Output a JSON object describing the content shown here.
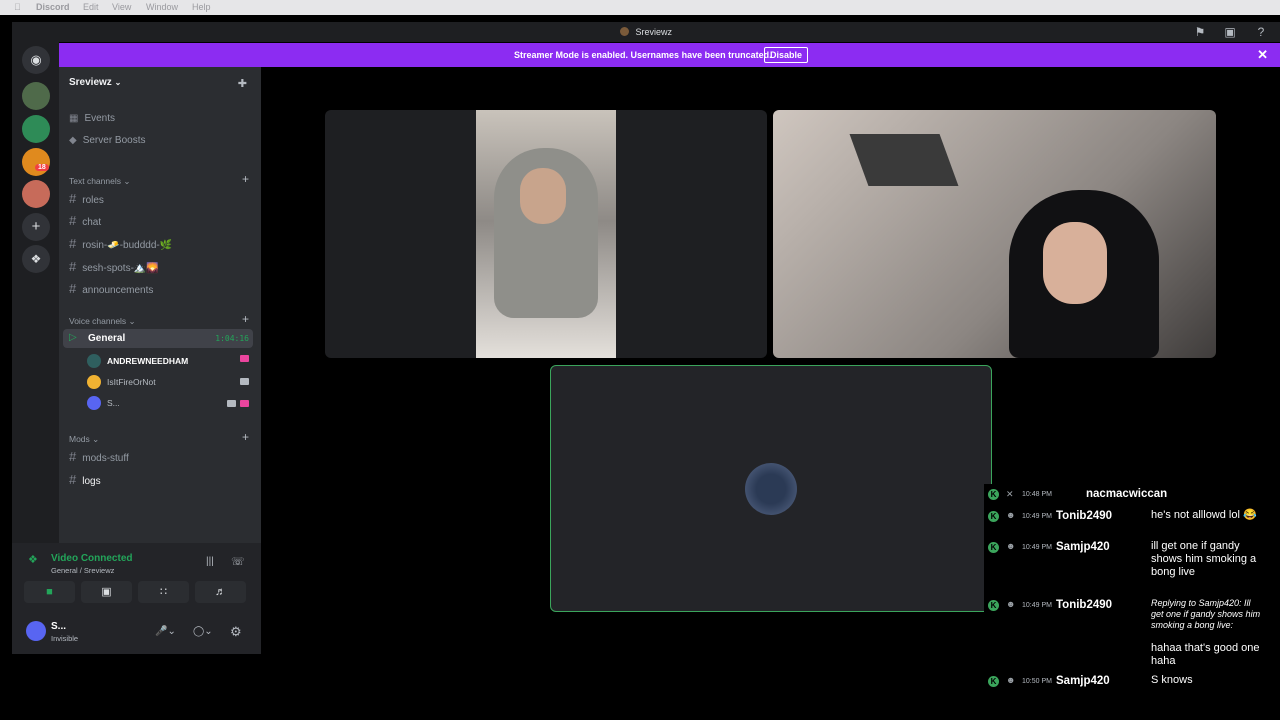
{
  "menubar": {
    "apple": "",
    "app": "Discord",
    "items": [
      "Edit",
      "View",
      "Window",
      "Help"
    ]
  },
  "window": {
    "title": "Sreviewz"
  },
  "banner": {
    "message": "Streamer Mode is enabled. Usernames have been truncated.",
    "button": "Disable"
  },
  "guilds": {
    "badge": "18"
  },
  "server": {
    "name": "Sreviewz",
    "top_items": [
      {
        "label": "Events"
      },
      {
        "label": "Server Boosts"
      }
    ],
    "text_category": "Text channels",
    "text_channels": [
      "roles",
      "chat",
      "rosin-🧈-budddd-🌿",
      "sesh-spots-🏔️🌄",
      "announcements"
    ],
    "voice_category": "Voice channels",
    "voice_channel": {
      "name": "General",
      "timer": "1:04:16"
    },
    "voice_users": [
      {
        "name": "ANDREWNEEDHAM"
      },
      {
        "name": "IsItFireOrNot"
      },
      {
        "name": "S..."
      }
    ],
    "mods_category": "Mods",
    "mods_channels": [
      "mods-stuff",
      "logs"
    ]
  },
  "voice_panel": {
    "status": "Video Connected",
    "location": "General / Sreviewz"
  },
  "user_panel": {
    "name": "S...",
    "status": "Invisible"
  },
  "chat": [
    {
      "time": "10:48 PM",
      "name": "nacmacwiccan",
      "text": ""
    },
    {
      "time": "10:49 PM",
      "name": "Tonib2490",
      "text": "he's not alllowd lol 😂"
    },
    {
      "time": "10:49 PM",
      "name": "Samjp420",
      "text": "ill get one if gandy shows him smoking a bong live"
    },
    {
      "time": "10:49 PM",
      "name": "Tonib2490",
      "reply": "Replying to Samjp420: Ill get one if gandy shows him smoking a bong live:",
      "text": "hahaa that's good one haha"
    },
    {
      "time": "10:50 PM",
      "name": "Samjp420",
      "text": "S knows"
    }
  ]
}
